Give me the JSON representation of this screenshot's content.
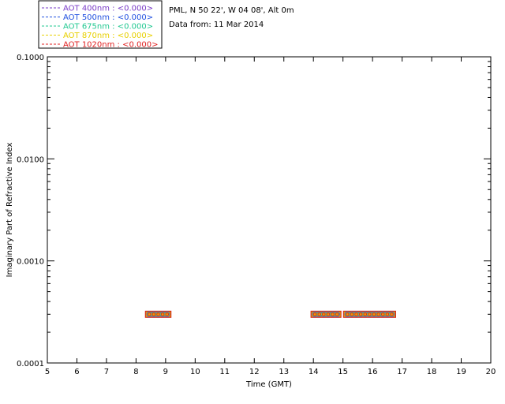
{
  "chart_data": {
    "type": "scatter",
    "title_lines": [
      "PML, N 50 22', W 04 08', Alt 0m",
      "Data from: 11 Mar 2014"
    ],
    "xlabel": "Time (GMT)",
    "ylabel": "Imaginary Part of Refractive Index",
    "xlim": [
      5,
      20
    ],
    "ylim": [
      0.0001,
      0.1
    ],
    "y_scale": "log",
    "x_ticks": [
      "5",
      "6",
      "7",
      "8",
      "9",
      "10",
      "11",
      "12",
      "13",
      "14",
      "15",
      "16",
      "17",
      "18",
      "19",
      "20"
    ],
    "y_ticks": [
      {
        "value": 0.0001,
        "label": "0.0001"
      },
      {
        "value": 0.001,
        "label": "0.0010"
      },
      {
        "value": 0.01,
        "label": "0.0100"
      },
      {
        "value": 0.1,
        "label": "0.1000"
      }
    ],
    "grid": false,
    "legend_position": "top-left, outside plot",
    "series": [
      {
        "name": "AOT  400nm : <0.000>",
        "color": "#7a3cc8",
        "marker": "#7a3cc8",
        "x": [
          8.45,
          8.6,
          8.75,
          8.9,
          9.05,
          14.05,
          14.2,
          14.35,
          14.5,
          14.65,
          14.8,
          15.15,
          15.3,
          15.45,
          15.6,
          15.75,
          15.9,
          16.05,
          16.2,
          16.35,
          16.5,
          16.65
        ],
        "y": [
          0.0003,
          0.0003,
          0.0003,
          0.0003,
          0.0003,
          0.0003,
          0.0003,
          0.0003,
          0.0003,
          0.0003,
          0.0003,
          0.0003,
          0.0003,
          0.0003,
          0.0003,
          0.0003,
          0.0003,
          0.0003,
          0.0003,
          0.0003,
          0.0003,
          0.0003
        ]
      },
      {
        "name": "AOT  500nm : <0.000>",
        "color": "#2050e0",
        "marker": "#2050e0",
        "x": [
          8.45,
          8.6,
          8.75,
          8.9,
          9.05,
          14.05,
          14.2,
          14.35,
          14.5,
          14.65,
          14.8,
          15.15,
          15.3,
          15.45,
          15.6,
          15.75,
          15.9,
          16.05,
          16.2,
          16.35,
          16.5,
          16.65
        ],
        "y": [
          0.0003,
          0.0003,
          0.0003,
          0.0003,
          0.0003,
          0.0003,
          0.0003,
          0.0003,
          0.0003,
          0.0003,
          0.0003,
          0.0003,
          0.0003,
          0.0003,
          0.0003,
          0.0003,
          0.0003,
          0.0003,
          0.0003,
          0.0003,
          0.0003,
          0.0003
        ]
      },
      {
        "name": "AOT  675nm : <0.000>",
        "color": "#20c890",
        "marker": "#20c890",
        "x": [
          8.45,
          8.6,
          8.75,
          8.9,
          9.05,
          14.05,
          14.2,
          14.35,
          14.5,
          14.65,
          14.8,
          15.15,
          15.3,
          15.45,
          15.6,
          15.75,
          15.9,
          16.05,
          16.2,
          16.35,
          16.5,
          16.65
        ],
        "y": [
          0.0003,
          0.0003,
          0.0003,
          0.0003,
          0.0003,
          0.0003,
          0.0003,
          0.0003,
          0.0003,
          0.0003,
          0.0003,
          0.0003,
          0.0003,
          0.0003,
          0.0003,
          0.0003,
          0.0003,
          0.0003,
          0.0003,
          0.0003,
          0.0003,
          0.0003
        ]
      },
      {
        "name": "AOT  870nm : <0.000>",
        "color": "#e8d000",
        "marker": "#e8d000",
        "x": [
          8.45,
          8.6,
          8.75,
          8.9,
          9.05,
          14.05,
          14.2,
          14.35,
          14.5,
          14.65,
          14.8,
          15.15,
          15.3,
          15.45,
          15.6,
          15.75,
          15.9,
          16.05,
          16.2,
          16.35,
          16.5,
          16.65
        ],
        "y": [
          0.0003,
          0.0003,
          0.0003,
          0.0003,
          0.0003,
          0.0003,
          0.0003,
          0.0003,
          0.0003,
          0.0003,
          0.0003,
          0.0003,
          0.0003,
          0.0003,
          0.0003,
          0.0003,
          0.0003,
          0.0003,
          0.0003,
          0.0003,
          0.0003,
          0.0003
        ]
      },
      {
        "name": "AOT 1020nm : <0.000>",
        "color": "#e02020",
        "marker": "#e02020",
        "x": [
          8.45,
          8.6,
          8.75,
          8.9,
          9.05,
          14.05,
          14.2,
          14.35,
          14.5,
          14.65,
          14.8,
          15.15,
          15.3,
          15.45,
          15.6,
          15.75,
          15.9,
          16.05,
          16.2,
          16.35,
          16.5,
          16.65
        ],
        "y": [
          0.0003,
          0.0003,
          0.0003,
          0.0003,
          0.0003,
          0.0003,
          0.0003,
          0.0003,
          0.0003,
          0.0003,
          0.0003,
          0.0003,
          0.0003,
          0.0003,
          0.0003,
          0.0003,
          0.0003,
          0.0003,
          0.0003,
          0.0003,
          0.0003,
          0.0003
        ]
      }
    ]
  }
}
